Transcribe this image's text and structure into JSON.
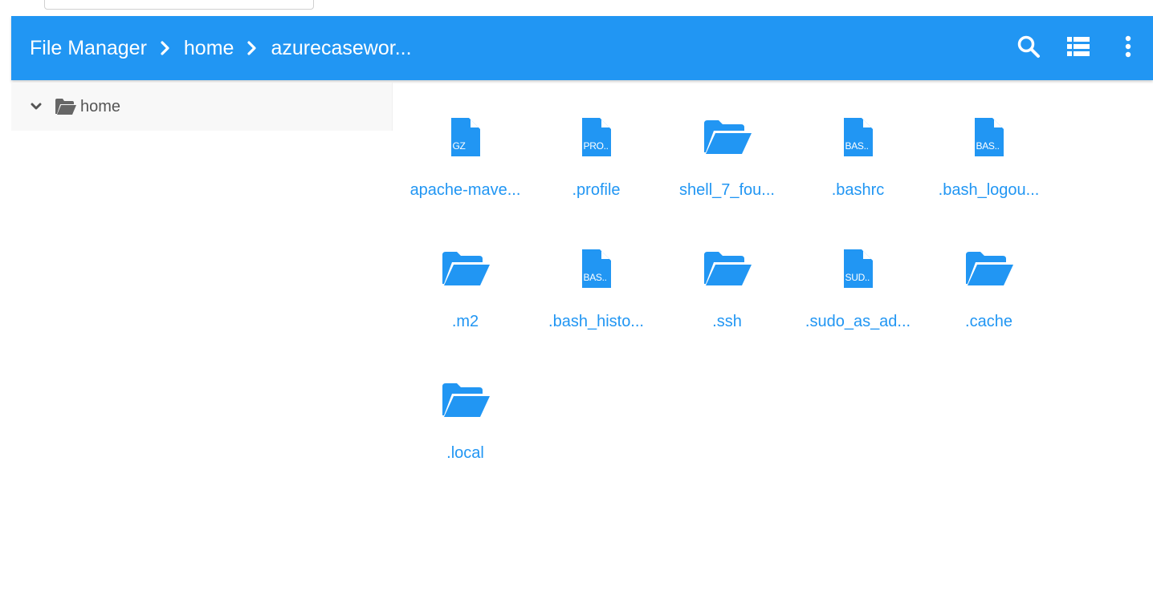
{
  "app": {
    "title": "File Manager"
  },
  "breadcrumbs": [
    {
      "label": "File Manager"
    },
    {
      "label": "home"
    },
    {
      "label": "azurecasewor..."
    }
  ],
  "toolbar": {
    "icons": [
      "search-icon",
      "list-view-icon",
      "more-vert-icon"
    ]
  },
  "sidebar": {
    "items": [
      {
        "label": "home",
        "icon": "folder-open-icon",
        "expanded": true
      }
    ]
  },
  "files": [
    {
      "name": "apache-mave...",
      "type": "file",
      "ext": "GZ"
    },
    {
      "name": ".profile",
      "type": "file",
      "ext": "PRO.."
    },
    {
      "name": "shell_7_fou...",
      "type": "folder"
    },
    {
      "name": ".bashrc",
      "type": "file",
      "ext": "BAS.."
    },
    {
      "name": ".bash_logou...",
      "type": "file",
      "ext": "BAS.."
    },
    {
      "name": ".m2",
      "type": "folder"
    },
    {
      "name": ".bash_histo...",
      "type": "file",
      "ext": "BAS.."
    },
    {
      "name": ".ssh",
      "type": "folder"
    },
    {
      "name": ".sudo_as_ad...",
      "type": "file",
      "ext": "SUD.."
    },
    {
      "name": ".cache",
      "type": "folder"
    },
    {
      "name": ".local",
      "type": "folder"
    }
  ],
  "colors": {
    "accent": "#2196f3",
    "sidebar_bg": "#f8f8f8",
    "tree_text": "#555555"
  }
}
